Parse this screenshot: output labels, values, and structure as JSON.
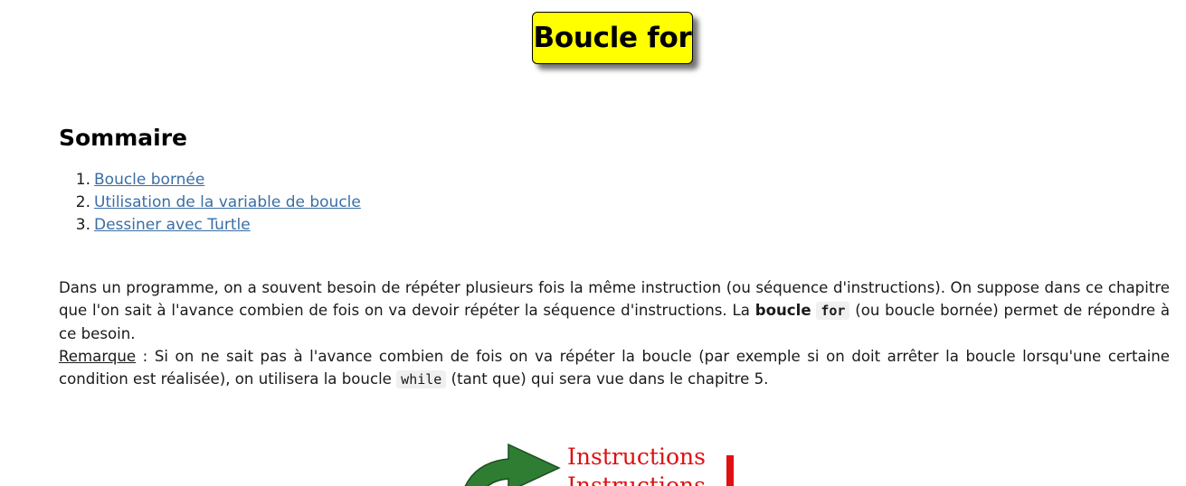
{
  "page": {
    "title": "Boucle for"
  },
  "sommaire": {
    "heading": "Sommaire",
    "items": [
      {
        "num": "1.",
        "label": "Boucle bornée"
      },
      {
        "num": "2.",
        "label": "Utilisation de la variable de boucle"
      },
      {
        "num": "3.",
        "label": "Dessiner avec Turtle"
      }
    ]
  },
  "intro": {
    "p1_a": "Dans un programme, on a souvent besoin de répéter plusieurs fois la même instruction (ou séquence d'instructions). On suppose dans ce chapitre que l'on sait à l'avance combien de fois on va devoir répéter la séquence d'instructions. La ",
    "p1_bold": "boucle",
    "p1_code": "for",
    "p1_b": " (ou boucle bornée) permet de répondre à ce besoin.",
    "remark_label": "Remarque",
    "p2_a": " : Si on ne sait pas à l'avance combien de fois on va répéter la boucle (par exemple si on doit arrêter la boucle lorsqu'une certaine condition est réalisée), on utilisera la boucle ",
    "p2_code": "while",
    "p2_b": " (tant que) qui sera vue dans le chapitre 5."
  },
  "diagram": {
    "label1": "Instructions",
    "label2": "Instructions",
    "arrow_icon": "loop-arrow-icon",
    "arrow_color": "#2e7d32",
    "text_color": "#e01010"
  }
}
